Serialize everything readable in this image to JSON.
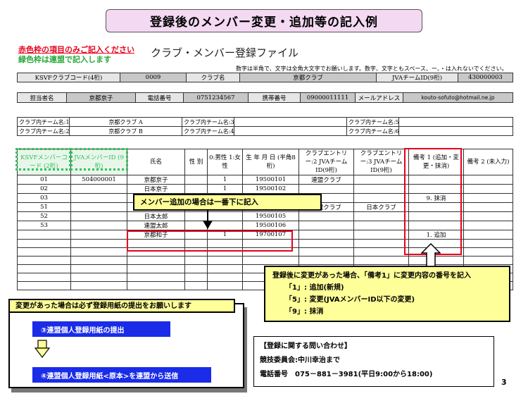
{
  "title": "登録後のメンバー変更・追加等の記入例",
  "notes": {
    "red": "赤色枠の項目のみご記入ください",
    "green": "緑色枠は連盟で記入します"
  },
  "form_title": "クラブ・メンバー登録ファイル",
  "small_note": "数字は半角で、文字は全角大文字でお願いします。数字、文字ともスペース、ー、・は入れないでください。",
  "row1": {
    "ksvf_label": "KSVFクラブコード(4桁)",
    "ksvf_value": "0009",
    "club_label": "クラブ名",
    "club_value": "京都クラブ",
    "jva_label": "JVAチームID(9桁)",
    "jva_value": "430000003"
  },
  "row2": {
    "rep_label": "担当者名",
    "rep_value": "京都京子",
    "tel_label": "電話番号",
    "tel_value": "0751234567",
    "mobile_label": "携帯番号",
    "mobile_value": "09000011111",
    "mail_label": "メールアドレス",
    "mail_value": "kouto-sofuto@hotmail.ne.jp"
  },
  "teams": [
    {
      "c1": "クラブ内チーム名:1",
      "c2": "京都クラブ A",
      "c3": "クラブ内チーム名:3",
      "c4": "",
      "c5": "クラブ内チーム名:5",
      "c6": ""
    },
    {
      "c1": "クラブ内チーム名:2",
      "c2": "京都クラブ B",
      "c3": "クラブ内チーム名:4",
      "c4": "",
      "c5": "クラブ内チーム名:6",
      "c6": ""
    }
  ],
  "headers": {
    "ksvf_id": "KSVFメンバーコード (2桁)",
    "jva_id": "JVAメンバーID (9桁)",
    "name": "氏名",
    "sex": "性 別",
    "sex_code": "0:男性 1:女性",
    "birth": "生 年 月 日 (半角8桁)",
    "entry2": "クラブエントリー:2 JVAチームID(9桁)",
    "entry3": "クラブエントリー:3 JVAチームID(9桁)",
    "note1": "備考 1 (追加・変更・抹消)",
    "note2": "備考 2 (未入力)"
  },
  "rows": [
    {
      "id": "01",
      "jva": "504000001",
      "name": "京都京子",
      "sex": "1",
      "birth": "19500101",
      "e2": "連盟クラブ",
      "e3": "",
      "n1": "",
      "n2": ""
    },
    {
      "id": "02",
      "jva": "",
      "name": "日本京子",
      "sex": "1",
      "birth": "19500102",
      "e2": "",
      "e3": "",
      "n1": "",
      "n2": ""
    },
    {
      "id": "03",
      "jva": "",
      "name": "",
      "sex": "",
      "birth": "",
      "e2": "",
      "e3": "",
      "n1": "9. 抹消",
      "n2": ""
    },
    {
      "id": "51",
      "jva": "",
      "name": "",
      "sex": "",
      "birth": "19500104",
      "e2": "連盟クラブ",
      "e3": "日本クラブ",
      "n1": "",
      "n2": ""
    },
    {
      "id": "52",
      "jva": "",
      "name": "日本太郎",
      "sex": "",
      "birth": "19500105",
      "e2": "",
      "e3": "",
      "n1": "",
      "n2": ""
    },
    {
      "id": "53",
      "jva": "",
      "name": "連盟太郎",
      "sex": "",
      "birth": "19500106",
      "e2": "",
      "e3": "",
      "n1": "",
      "n2": ""
    },
    {
      "id": "",
      "jva": "",
      "name": "京都和子",
      "sex": "1",
      "birth": "19700107",
      "e2": "",
      "e3": "",
      "n1": "1. 追加",
      "n2": ""
    },
    {
      "id": "",
      "jva": "",
      "name": "",
      "sex": "",
      "birth": "",
      "e2": "",
      "e3": "",
      "n1": "",
      "n2": ""
    },
    {
      "id": "",
      "jva": "",
      "name": "",
      "sex": "",
      "birth": "",
      "e2": "",
      "e3": "",
      "n1": "",
      "n2": ""
    },
    {
      "id": "",
      "jva": "",
      "name": "",
      "sex": "",
      "birth": "",
      "e2": "",
      "e3": "",
      "n1": "",
      "n2": ""
    },
    {
      "id": "",
      "jva": "",
      "name": "",
      "sex": "",
      "birth": "",
      "e2": "",
      "e3": "",
      "n1": "",
      "n2": ""
    },
    {
      "id": "",
      "jva": "",
      "name": "",
      "sex": "",
      "birth": "",
      "e2": "",
      "e3": "",
      "n1": "",
      "n2": ""
    },
    {
      "id": "",
      "jva": "",
      "name": "",
      "sex": "",
      "birth": "",
      "e2": "",
      "e3": "",
      "n1": "",
      "n2": ""
    }
  ],
  "callout_add": "メンバー追加の場合は一番下に記入",
  "callout_change": {
    "line1": "登録後に変更があった場合、「備考1」に変更内容の番号を記入",
    "line2": "「1」: 追加(新規)",
    "line3": "「5」: 変更(JVAメンバーID以下の変更)",
    "line4": "「9」: 抹消"
  },
  "procedure": {
    "header": "変更があった場合は必ず登録用紙の提出をお願いします",
    "step1": "③連盟個人登録用紙の提出",
    "step2": "④連盟個人登録用紙<原本>を連盟から送信"
  },
  "contact": {
    "title": "【登録に関する問い合わせ】",
    "committee": "競技委員会:中川幸治まで",
    "phone": "電話番号　075－881－3981(平日9:00から18:00)"
  },
  "page_number": "3",
  "colors": {
    "title_bg": "#f3d9f2",
    "red": "#e8001c",
    "green": "#2fc25a",
    "callout_bg": "#ffff99",
    "button_blue": "#1a2ce8"
  }
}
